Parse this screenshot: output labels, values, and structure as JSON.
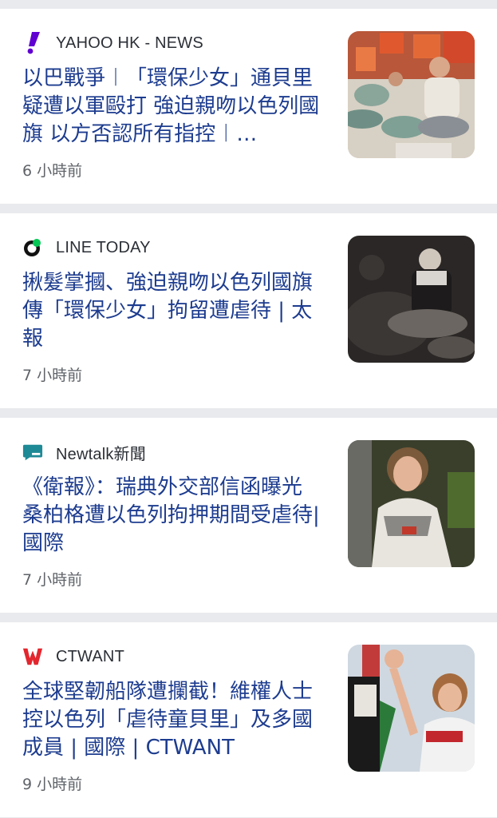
{
  "feed": {
    "items": [
      {
        "source": "YAHOO HK - NEWS",
        "source_icon": "yahoo-exclamation-icon",
        "headline": "以巴戰爭︱「環保少女」通貝里疑遭以軍毆打 強迫親吻以色列國旗 以方否認所有指控︱…",
        "time": "6 小時前",
        "thumbnail": "people-seated-with-life-vests-image"
      },
      {
        "source": "LINE TODAY",
        "source_icon": "line-today-logo-icon",
        "headline": "揪髮掌摑、強迫親吻以色列國旗 傳「環保少女」拘留遭虐待 | 太報",
        "time": "7 小時前",
        "thumbnail": "woman-sitting-in-dark-image"
      },
      {
        "source": "Newtalk新聞",
        "source_icon": "newtalk-speech-bubble-icon",
        "headline": "《衛報》：瑞典外交部信函曝光 桑柏格遭以色列拘押期間受虐待| 國際",
        "time": "7 小時前",
        "thumbnail": "woman-in-keffiyeh-image"
      },
      {
        "source": "CTWANT",
        "source_icon": "ctwant-w-logo-icon",
        "headline": "全球堅韌船隊遭攔截！維權人士控以色列「虐待童貝里」及多國成員 | 國際 | CTWANT",
        "time": "9 小時前",
        "thumbnail": "woman-waving-at-rally-image"
      }
    ]
  },
  "colors": {
    "headline": "#1d3c8f",
    "separator": "#e8eaed",
    "yahoo": "#6001d2",
    "line": "#06c755",
    "newtalk": "#1e8a96",
    "ctwant": "#e3262e"
  }
}
